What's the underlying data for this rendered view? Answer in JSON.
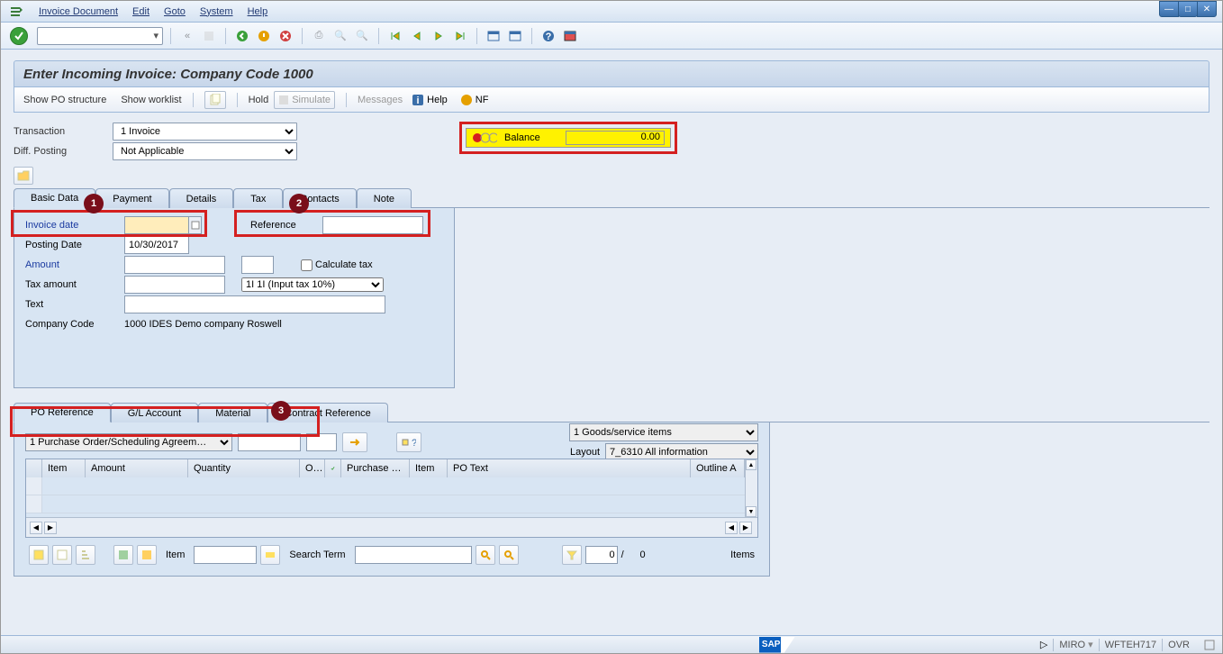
{
  "menu": {
    "items": [
      "Invoice Document",
      "Edit",
      "Goto",
      "System",
      "Help"
    ]
  },
  "title": "Enter Incoming Invoice: Company Code 1000",
  "app_toolbar": {
    "show_po": "Show PO structure",
    "show_worklist": "Show worklist",
    "hold": "Hold",
    "simulate": "Simulate",
    "messages": "Messages",
    "help": "Help",
    "nf": "NF"
  },
  "form": {
    "transaction_label": "Transaction",
    "transaction_value": "1 Invoice",
    "diff_posting_label": "Diff. Posting",
    "diff_posting_value": "Not Applicable",
    "balance_label": "Balance",
    "balance_value": "0.00"
  },
  "tabs_upper": [
    "Basic Data",
    "Payment",
    "Details",
    "Tax",
    "Contacts",
    "Note"
  ],
  "basic": {
    "invoice_date_label": "Invoice date",
    "invoice_date_value": "",
    "reference_label": "Reference",
    "reference_value": "",
    "posting_date_label": "Posting Date",
    "posting_date_value": "10/30/2017",
    "amount_label": "Amount",
    "amount_value": "",
    "currency_value": "",
    "calc_tax_label": "Calculate tax",
    "tax_amount_label": "Tax amount",
    "tax_amount_value": "",
    "tax_code_value": "1I 1I (Input tax 10%)",
    "text_label": "Text",
    "text_value": "",
    "company_code_label": "Company Code",
    "company_code_value": "1000 IDES Demo company Roswell"
  },
  "tabs_lower": [
    "PO Reference",
    "G/L Account",
    "Material",
    "Contract Reference"
  ],
  "po": {
    "category": "1 Purchase Order/Scheduling Agreem…",
    "po_number": "",
    "goods_items": "1 Goods/service items",
    "layout_label": "Layout",
    "layout_value": "7_6310 All information",
    "columns": [
      "",
      "Item",
      "Amount",
      "Quantity",
      "O…",
      "",
      "Purchase …",
      "Item",
      "PO Text",
      "Outline A"
    ]
  },
  "grid_tb": {
    "item_label": "Item",
    "item_value": "",
    "search_label": "Search Term",
    "search_value": "",
    "pos_cur": "0",
    "pos_sep": "/",
    "pos_total": "0",
    "items_label": "Items"
  },
  "status": {
    "tcode": "MIRO",
    "system": "WFTEH717",
    "mode": "OVR"
  },
  "callouts": {
    "c1": "1",
    "c2": "2",
    "c3": "3"
  }
}
